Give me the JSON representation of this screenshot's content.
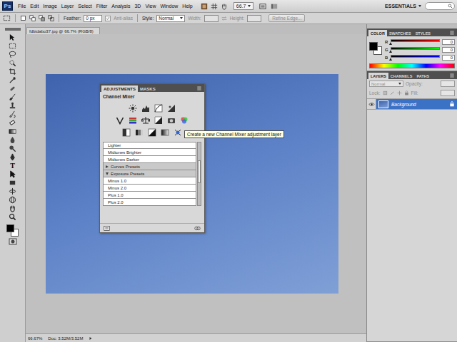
{
  "menu_bar": {
    "logo": "Ps",
    "menus": [
      "File",
      "Edit",
      "Image",
      "Layer",
      "Select",
      "Filter",
      "Analysis",
      "3D",
      "View",
      "Window",
      "Help"
    ],
    "zoom": "66.7",
    "workspace": "ESSENTIALS"
  },
  "options_bar": {
    "feather_label": "Feather:",
    "feather_value": "0 px",
    "anti_alias": {
      "label": "Anti-alias",
      "checked": true,
      "disabled": true
    },
    "style_label": "Style:",
    "style_value": "Normal",
    "width_label": "Width:",
    "height_label": "Height:",
    "refine_edge": {
      "label": "Refine Edge...",
      "disabled": true
    }
  },
  "tools": {
    "type_glyph": "T"
  },
  "document": {
    "tab": "fdbtdabo37.jpg @ 66.7% (RGB/8)"
  },
  "adjustments_panel": {
    "tabs": [
      {
        "label": "ADJUSTMENTS",
        "selected": true
      },
      {
        "label": "MASKS",
        "selected": false
      }
    ],
    "title": "Channel Mixer",
    "tooltip": "Create a new Channel Mixer adjustment layer",
    "presets": [
      {
        "label": "Lighter",
        "kind": "preset"
      },
      {
        "label": "Midtones Brighter",
        "kind": "preset"
      },
      {
        "label": "Midtones Darker",
        "kind": "preset"
      },
      {
        "label": "Curves Presets",
        "kind": "group",
        "expanded": false
      },
      {
        "label": "Exposure Presets",
        "kind": "group",
        "expanded": true
      },
      {
        "label": "Minus 1.0",
        "kind": "preset"
      },
      {
        "label": "Minus 2.0",
        "kind": "preset"
      },
      {
        "label": "Plus 1.0",
        "kind": "preset"
      },
      {
        "label": "Plus 2.0",
        "kind": "preset"
      }
    ],
    "scroll_level": 0.45
  },
  "color_panel": {
    "tabs": [
      {
        "label": "COLOR",
        "selected": true
      },
      {
        "label": "SWATCHES",
        "selected": false
      },
      {
        "label": "STYLES",
        "selected": false
      }
    ],
    "foreground": "#000000",
    "background": "#ffffff",
    "sliders": [
      {
        "name": "R",
        "value": "0",
        "level": 0,
        "color": "#ff0000"
      },
      {
        "name": "G",
        "value": "0",
        "level": 0,
        "color": "#00ff00"
      },
      {
        "name": "B",
        "value": "0",
        "level": 0,
        "color": "#0000ff"
      }
    ]
  },
  "layers_panel": {
    "tabs": [
      {
        "label": "LAYERS",
        "selected": true
      },
      {
        "label": "CHANNELS",
        "selected": false
      },
      {
        "label": "PATHS",
        "selected": false
      }
    ],
    "blend_mode": "Normal",
    "opacity_label": "Opacity:",
    "lock_label": "Lock:",
    "fill_label": "Fill:",
    "controls_disabled": true,
    "layers": [
      {
        "name": "Background",
        "selected": true,
        "visible": true,
        "locked": true
      }
    ]
  },
  "status_bar": {
    "zoom": "66.67%",
    "doc": "Doc: 3.52M/3.52M"
  }
}
